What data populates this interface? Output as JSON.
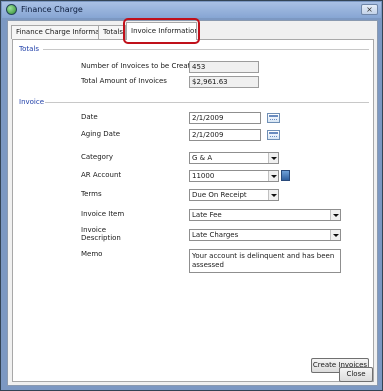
{
  "window": {
    "title": "Finance Charge",
    "close_glyph": "×"
  },
  "tabs": [
    {
      "label": "Finance Charge Information"
    },
    {
      "label": "Totals"
    },
    {
      "label": "Invoice Information"
    }
  ],
  "totals": {
    "heading": "Totals",
    "invoices_count_label": "Number of Invoices to be Created",
    "invoices_count_value": "453",
    "total_amount_label": "Total Amount of Invoices",
    "total_amount_value": "$2,961.63"
  },
  "invoice": {
    "heading": "Invoice",
    "date_label": "Date",
    "date_value": "2/1/2009",
    "aging_date_label": "Aging Date",
    "aging_date_value": "2/1/2009",
    "category_label": "Category",
    "category_value": "G & A",
    "ar_account_label": "AR Account",
    "ar_account_value": "11000",
    "terms_label": "Terms",
    "terms_value": "Due On Receipt",
    "invoice_item_label": "Invoice Item",
    "invoice_item_value": "Late Fee",
    "invoice_description_label_1": "Invoice",
    "invoice_description_label_2": "Description",
    "invoice_description_value": "Late Charges",
    "memo_label": "Memo",
    "memo_value": "Your account is delinquent and has been assessed"
  },
  "buttons": {
    "create_invoices": "Create Invoices",
    "close": "Close"
  },
  "colors": {
    "section_heading": "#1f3fa8",
    "highlight": "#c0101a",
    "window_frame": "#7c98c2"
  }
}
